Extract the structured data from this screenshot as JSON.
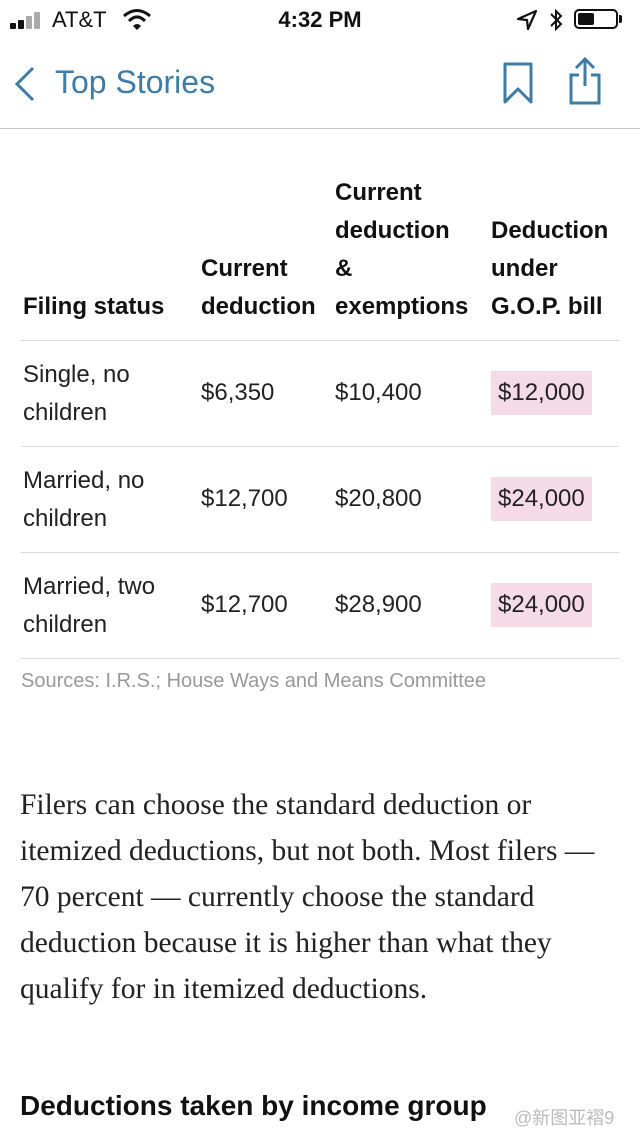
{
  "status_bar": {
    "carrier": "AT&T",
    "time": "4:32 PM",
    "icons": [
      "signal-bars-icon",
      "wifi-icon",
      "location-arrow-icon",
      "bluetooth-icon",
      "battery-icon"
    ]
  },
  "nav": {
    "back_label": "Top Stories",
    "icons": [
      "chevron-left-icon",
      "bookmark-icon",
      "share-icon"
    ],
    "accent_color": "#3e7ca6"
  },
  "table": {
    "headers": [
      [
        "Filing status"
      ],
      [
        "Current",
        "deduction"
      ],
      [
        "Current",
        "deduction",
        "&",
        "exemptions"
      ],
      [
        "Deduction",
        "under",
        "G.O.P. bill"
      ]
    ],
    "rows": [
      {
        "status": [
          "Single, no",
          "children"
        ],
        "current": "$6,350",
        "with_exemptions": "$10,400",
        "gop": "$12,000"
      },
      {
        "status": [
          "Married, no",
          "children"
        ],
        "current": "$12,700",
        "with_exemptions": "$20,800",
        "gop": "$24,000"
      },
      {
        "status": [
          "Married, two",
          "children"
        ],
        "current": "$12,700",
        "with_exemptions": "$28,900",
        "gop": "$24,000"
      }
    ],
    "highlight_color": "#f4dbe6",
    "source": "Sources: I.R.S.; House Ways and Means Committee"
  },
  "article": {
    "paragraph": "Filers can choose the standard deduction or itemized deductions, but not both. Most filers — 70 percent — currently choose the standard deduction because it is higher than what they qualify for in itemized deductions.",
    "subhead": "Deductions taken by income group"
  },
  "watermark": "@新图亚褶9"
}
